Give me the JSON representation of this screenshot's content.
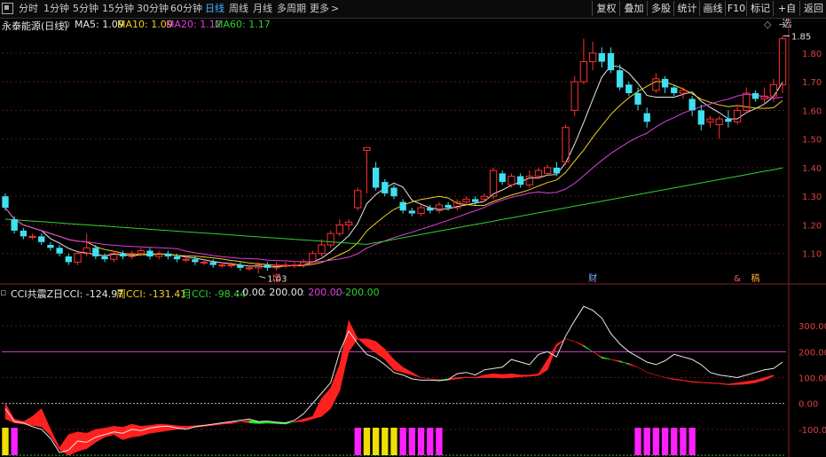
{
  "toolbar": {
    "periods": [
      "分时",
      "1分钟",
      "5分钟",
      "15分钟",
      "30分钟",
      "60分钟",
      "日线",
      "周线",
      "月线",
      "多周期",
      "更多"
    ],
    "active": "日线",
    "more_arrow": ">",
    "right_buttons": [
      "复权",
      "叠加",
      "多股",
      "统计",
      "画线",
      "F10",
      "标记",
      "+自选",
      "返回"
    ]
  },
  "main_chart": {
    "title": "永泰能源(日线)",
    "ma": [
      {
        "label": "MA5: 1.09",
        "color": "#e8e8e8"
      },
      {
        "label": "MA10: 1.09",
        "color": "#f0d020"
      },
      {
        "label": "MA20: 1.12",
        "color": "#e040e0"
      },
      {
        "label": "MA60: 1.17",
        "color": "#30d030"
      }
    ],
    "high_label": "1.85",
    "low_label": "1.03",
    "y_ticks": [
      "1.80",
      "1.70",
      "1.60",
      "1.50",
      "1.40",
      "1.30",
      "1.20",
      "1.10"
    ],
    "markers": [
      {
        "text": "增",
        "color": "#ff6060"
      },
      {
        "text": "财",
        "color": "#7fb0ff"
      },
      {
        "text": "&",
        "color": "#ff6060"
      },
      {
        "text": "稿",
        "color": "#ffb030"
      }
    ]
  },
  "sub_chart": {
    "title": "CCI共震Z",
    "items": [
      {
        "label": "日CCI: -124.97",
        "color": "#e8e8e8"
      },
      {
        "label": "周CCI: -131.41",
        "color": "#f0d020"
      },
      {
        "label": "月CCI: -98.44",
        "color": "#30d030"
      },
      {
        "label": ": 0.00",
        "color": "#e8e8e8"
      },
      {
        "label": ": 200.00",
        "color": "#e8e8e8"
      },
      {
        "label": ": 200.00",
        "color": "#e040e0"
      },
      {
        "label": ": -200.00",
        "color": "#30d030"
      }
    ],
    "y_ticks": [
      "300.00",
      "200.00",
      "100.00",
      "0.00",
      "-100.00"
    ]
  },
  "chart_data": {
    "type": "candlestick",
    "title": "永泰能源(日线)",
    "ylim": [
      1.0,
      1.88
    ],
    "candles": [
      [
        1.3,
        1.26,
        1.31,
        1.25
      ],
      [
        1.22,
        1.18,
        1.23,
        1.17
      ],
      [
        1.18,
        1.16,
        1.19,
        1.15
      ],
      [
        1.16,
        1.16,
        1.17,
        1.15
      ],
      [
        1.16,
        1.14,
        1.17,
        1.13
      ],
      [
        1.13,
        1.12,
        1.14,
        1.11
      ],
      [
        1.12,
        1.1,
        1.13,
        1.09
      ],
      [
        1.09,
        1.07,
        1.1,
        1.06
      ],
      [
        1.07,
        1.1,
        1.11,
        1.06
      ],
      [
        1.1,
        1.12,
        1.17,
        1.09
      ],
      [
        1.12,
        1.09,
        1.13,
        1.08
      ],
      [
        1.09,
        1.08,
        1.1,
        1.07
      ],
      [
        1.08,
        1.1,
        1.11,
        1.07
      ],
      [
        1.1,
        1.09,
        1.11,
        1.08
      ],
      [
        1.09,
        1.1,
        1.11,
        1.08
      ],
      [
        1.1,
        1.11,
        1.12,
        1.09
      ],
      [
        1.11,
        1.09,
        1.12,
        1.08
      ],
      [
        1.09,
        1.1,
        1.11,
        1.08
      ],
      [
        1.1,
        1.09,
        1.11,
        1.08
      ],
      [
        1.09,
        1.08,
        1.1,
        1.07
      ],
      [
        1.08,
        1.08,
        1.09,
        1.07
      ],
      [
        1.08,
        1.07,
        1.09,
        1.06
      ],
      [
        1.07,
        1.07,
        1.08,
        1.06
      ],
      [
        1.07,
        1.06,
        1.08,
        1.05
      ],
      [
        1.06,
        1.06,
        1.07,
        1.05
      ],
      [
        1.06,
        1.06,
        1.07,
        1.05
      ],
      [
        1.06,
        1.05,
        1.07,
        1.04
      ],
      [
        1.05,
        1.05,
        1.06,
        1.04
      ],
      [
        1.05,
        1.06,
        1.07,
        1.03
      ],
      [
        1.06,
        1.05,
        1.07,
        1.04
      ],
      [
        1.05,
        1.06,
        1.07,
        1.04
      ],
      [
        1.06,
        1.06,
        1.07,
        1.05
      ],
      [
        1.06,
        1.06,
        1.07,
        1.05
      ],
      [
        1.06,
        1.07,
        1.08,
        1.05
      ],
      [
        1.07,
        1.1,
        1.11,
        1.06
      ],
      [
        1.1,
        1.13,
        1.15,
        1.09
      ],
      [
        1.13,
        1.17,
        1.18,
        1.12
      ],
      [
        1.17,
        1.2,
        1.22,
        1.16
      ],
      [
        1.2,
        1.21,
        1.22,
        1.18
      ],
      [
        1.26,
        1.32,
        1.33,
        1.25
      ],
      [
        1.46,
        1.47,
        1.47,
        1.31
      ],
      [
        1.4,
        1.33,
        1.42,
        1.32
      ],
      [
        1.35,
        1.31,
        1.36,
        1.3
      ],
      [
        1.33,
        1.3,
        1.34,
        1.29
      ],
      [
        1.28,
        1.25,
        1.29,
        1.24
      ],
      [
        1.25,
        1.24,
        1.26,
        1.23
      ],
      [
        1.24,
        1.26,
        1.27,
        1.23
      ],
      [
        1.26,
        1.25,
        1.27,
        1.24
      ],
      [
        1.25,
        1.27,
        1.28,
        1.24
      ],
      [
        1.27,
        1.26,
        1.28,
        1.25
      ],
      [
        1.26,
        1.28,
        1.29,
        1.25
      ],
      [
        1.28,
        1.29,
        1.3,
        1.27
      ],
      [
        1.29,
        1.28,
        1.3,
        1.27
      ],
      [
        1.29,
        1.3,
        1.31,
        1.28
      ],
      [
        1.3,
        1.39,
        1.4,
        1.29
      ],
      [
        1.38,
        1.35,
        1.39,
        1.34
      ],
      [
        1.34,
        1.37,
        1.38,
        1.33
      ],
      [
        1.37,
        1.34,
        1.38,
        1.33
      ],
      [
        1.34,
        1.37,
        1.39,
        1.33
      ],
      [
        1.37,
        1.39,
        1.4,
        1.36
      ],
      [
        1.38,
        1.4,
        1.41,
        1.37
      ],
      [
        1.4,
        1.38,
        1.42,
        1.37
      ],
      [
        1.42,
        1.54,
        1.55,
        1.41
      ],
      [
        1.6,
        1.7,
        1.72,
        1.58
      ],
      [
        1.7,
        1.77,
        1.85,
        1.69
      ],
      [
        1.77,
        1.8,
        1.84,
        1.74
      ],
      [
        1.8,
        1.77,
        1.82,
        1.75
      ],
      [
        1.8,
        1.74,
        1.82,
        1.73
      ],
      [
        1.74,
        1.68,
        1.76,
        1.67
      ],
      [
        1.69,
        1.66,
        1.7,
        1.65
      ],
      [
        1.66,
        1.62,
        1.68,
        1.6
      ],
      [
        1.59,
        1.56,
        1.61,
        1.54
      ],
      [
        1.67,
        1.71,
        1.73,
        1.66
      ],
      [
        1.71,
        1.68,
        1.72,
        1.66
      ],
      [
        1.68,
        1.66,
        1.69,
        1.65
      ],
      [
        1.66,
        1.67,
        1.68,
        1.64
      ],
      [
        1.64,
        1.6,
        1.65,
        1.58
      ],
      [
        1.6,
        1.55,
        1.62,
        1.53
      ],
      [
        1.56,
        1.57,
        1.58,
        1.54
      ],
      [
        1.55,
        1.57,
        1.58,
        1.5
      ],
      [
        1.57,
        1.56,
        1.6,
        1.54
      ],
      [
        1.56,
        1.6,
        1.62,
        1.55
      ],
      [
        1.6,
        1.66,
        1.68,
        1.59
      ],
      [
        1.66,
        1.64,
        1.67,
        1.63
      ],
      [
        1.64,
        1.65,
        1.68,
        1.62
      ],
      [
        1.65,
        1.69,
        1.71,
        1.63
      ],
      [
        1.69,
        1.85,
        1.86,
        1.66
      ]
    ],
    "y_label_positions": [
      1.8,
      1.7,
      1.6,
      1.5,
      1.4,
      1.3,
      1.2,
      1.1
    ],
    "cci_ylim": [
      -200,
      400
    ],
    "cci_day": [
      -20,
      -70,
      -75,
      -90,
      -100,
      -135,
      -190,
      -180,
      -145,
      -150,
      -130,
      -120,
      -110,
      -115,
      -100,
      -105,
      -95,
      -90,
      -88,
      -95,
      -100,
      -90,
      -85,
      -80,
      -75,
      -70,
      -65,
      -60,
      -70,
      -68,
      -72,
      -75,
      -65,
      -40,
      0,
      40,
      80,
      200,
      280,
      230,
      190,
      175,
      150,
      120,
      110,
      95,
      90,
      90,
      88,
      92,
      115,
      120,
      110,
      130,
      135,
      140,
      170,
      160,
      150,
      190,
      200,
      180,
      260,
      320,
      375,
      360,
      330,
      270,
      230,
      200,
      180,
      160,
      150,
      165,
      190,
      180,
      170,
      150,
      120,
      110,
      105,
      100,
      110,
      120,
      130,
      135,
      160
    ],
    "cci_week": [
      0,
      -60,
      -70,
      -50,
      -20,
      -100,
      -170,
      -120,
      -110,
      -115,
      -100,
      -95,
      -88,
      -92,
      -80,
      -88,
      -85,
      -80,
      -82,
      -86,
      -88,
      -86,
      -83,
      -80,
      -75,
      -72,
      -70,
      -75,
      -78,
      -76,
      -78,
      -80,
      -70,
      -60,
      -50,
      20,
      60,
      150,
      320,
      250,
      250,
      240,
      210,
      170,
      140,
      120,
      100,
      95,
      90,
      95,
      100,
      102,
      100,
      110,
      115,
      112,
      115,
      110,
      110,
      115,
      170,
      230,
      250,
      240,
      220,
      200,
      175,
      170,
      160,
      155,
      140,
      120,
      110,
      100,
      95,
      90,
      85,
      82,
      80,
      78,
      75,
      80,
      85,
      90,
      100,
      110
    ],
    "cci_month": [
      -60,
      -75,
      -80,
      -85,
      -90,
      -125,
      -180,
      -200,
      -185,
      -175,
      -150,
      -130,
      -120,
      -140,
      -130,
      -125,
      -115,
      -110,
      -105,
      -100,
      -96,
      -92,
      -88,
      -85,
      -80,
      -78,
      -70,
      -65,
      -70,
      -72,
      -74,
      -75,
      -72,
      -70,
      -60,
      -50,
      -20,
      50,
      200,
      250,
      220,
      195,
      170,
      130,
      120,
      110,
      100,
      95,
      92,
      90,
      95,
      100,
      98,
      100,
      100,
      98,
      100,
      103,
      105,
      108,
      130,
      220,
      250,
      240,
      225,
      200,
      180,
      170,
      165,
      150,
      140,
      120,
      110,
      100,
      92,
      88,
      82,
      80,
      78,
      76,
      72,
      73,
      75,
      80,
      90,
      105
    ],
    "signal_bars": [
      {
        "index": 0,
        "color": "#f0e000"
      },
      {
        "index": 1,
        "color": "#ff20ff"
      },
      {
        "index": 39,
        "color": "#ff20ff"
      },
      {
        "index": 40,
        "color": "#f0e000"
      },
      {
        "index": 41,
        "color": "#f0e000"
      },
      {
        "index": 42,
        "color": "#f0e000"
      },
      {
        "index": 43,
        "color": "#f0e000"
      },
      {
        "index": 44,
        "color": "#ff20ff"
      },
      {
        "index": 45,
        "color": "#ff20ff"
      },
      {
        "index": 46,
        "color": "#ff20ff"
      },
      {
        "index": 47,
        "color": "#ff20ff"
      },
      {
        "index": 48,
        "color": "#ff20ff"
      },
      {
        "index": 70,
        "color": "#ff20ff"
      },
      {
        "index": 71,
        "color": "#ff20ff"
      },
      {
        "index": 72,
        "color": "#ff20ff"
      },
      {
        "index": 73,
        "color": "#ff20ff"
      },
      {
        "index": 74,
        "color": "#ff20ff"
      },
      {
        "index": 75,
        "color": "#ff20ff"
      },
      {
        "index": 76,
        "color": "#ff20ff"
      },
      {
        "index": 98,
        "color": "#ff20ff"
      }
    ]
  }
}
